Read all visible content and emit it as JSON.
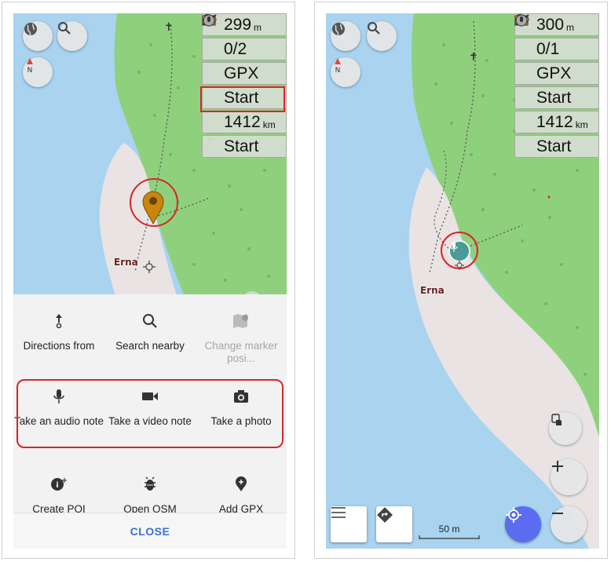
{
  "left": {
    "widgets": [
      {
        "icon": "altitude-icon",
        "value": "299",
        "unit": "m"
      },
      {
        "icon": "waypoint-icon",
        "value": "0/2",
        "unit": ""
      },
      {
        "icon": "gpx-record-icon",
        "value": "GPX",
        "unit": ""
      },
      {
        "icon": "camera-icon",
        "value": "Start",
        "unit": ""
      },
      {
        "icon": "distance-icon",
        "value": "1412",
        "unit": "km"
      },
      {
        "icon": "audio-note-icon",
        "value": "Start",
        "unit": ""
      }
    ],
    "place_label": "Erna",
    "menu": {
      "row1": [
        {
          "icon": "directions-icon",
          "label": "Directions from"
        },
        {
          "icon": "search-icon",
          "label": "Search nearby"
        },
        {
          "icon": "change-marker-icon",
          "label": "Change marker posi..."
        }
      ],
      "row2": [
        {
          "icon": "microphone-icon",
          "label": "Take an audio note"
        },
        {
          "icon": "video-camera-icon",
          "label": "Take a video note"
        },
        {
          "icon": "photo-camera-icon",
          "label": "Take a photo"
        }
      ],
      "row3": [
        {
          "icon": "create-poi-icon",
          "label": "Create POI"
        },
        {
          "icon": "osm-bug-icon",
          "label": "Open OSM"
        },
        {
          "icon": "add-gpx-icon",
          "label": "Add GPX"
        }
      ],
      "close_label": "CLOSE"
    }
  },
  "right": {
    "widgets": [
      {
        "icon": "altitude-icon",
        "value": "300",
        "unit": "m"
      },
      {
        "icon": "waypoint-icon",
        "value": "0/1",
        "unit": ""
      },
      {
        "icon": "gpx-record-icon",
        "value": "GPX",
        "unit": ""
      },
      {
        "icon": "camera-icon",
        "value": "Start",
        "unit": ""
      },
      {
        "icon": "distance-icon",
        "value": "1412",
        "unit": "km"
      },
      {
        "icon": "audio-note-icon",
        "value": "Start",
        "unit": ""
      }
    ],
    "place_label": "Erna",
    "scale_label": "50 m"
  },
  "colors": {
    "water": "#a9d3ef",
    "forest": "#8fd07c",
    "land": "#e9e3e3",
    "highlight": "#d7262a",
    "accent_blue": "#5b6cf0",
    "close_text": "#3a6fd8"
  }
}
